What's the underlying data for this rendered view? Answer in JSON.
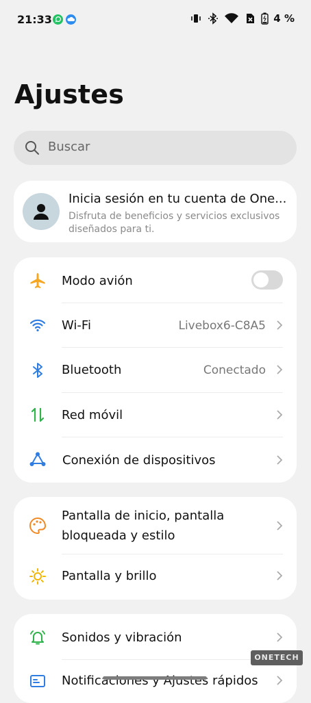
{
  "status_bar": {
    "time": "21:33",
    "battery": "4 %",
    "icons": [
      "whatsapp-icon",
      "cloud-app-icon",
      "vibrate-icon",
      "bluetooth-icon",
      "wifi-icon",
      "no-sim-icon",
      "battery-icon"
    ]
  },
  "page": {
    "title": "Ajustes"
  },
  "search": {
    "placeholder": "Buscar"
  },
  "account": {
    "title": "Inicia sesión en tu cuenta de One...",
    "subtitle": "Disfruta de beneficios y servicios exclusivos diseñados para ti."
  },
  "group1": {
    "airplane": {
      "label": "Modo avión",
      "enabled": false,
      "icon": "airplane-icon",
      "color": "#f5a623"
    },
    "wifi": {
      "label": "Wi-Fi",
      "value": "Livebox6-C8A5",
      "icon": "wifi-icon",
      "color": "#2f7de1"
    },
    "bluetooth": {
      "label": "Bluetooth",
      "value": "Conectado",
      "icon": "bluetooth-icon",
      "color": "#2f7de1"
    },
    "mobile": {
      "label": "Red móvil",
      "icon": "mobile-data-icon",
      "color": "#2fb34a"
    },
    "devices": {
      "label": "Conexión de dispositivos",
      "icon": "device-connection-icon",
      "color": "#2f7de1"
    }
  },
  "group2": {
    "home": {
      "label_line1": "Pantalla de inicio, pantalla",
      "label_line2": "bloqueada y estilo",
      "icon": "palette-icon",
      "color": "#f08a24"
    },
    "display": {
      "label": "Pantalla y brillo",
      "icon": "brightness-icon",
      "color": "#f5b400"
    }
  },
  "group3": {
    "sound": {
      "label": "Sonidos y vibración",
      "icon": "bell-icon",
      "color": "#2fb34a"
    },
    "notifications": {
      "label": "Notificaciones y Ajustes rápidos",
      "icon": "notifications-icon",
      "color": "#2f7de1"
    }
  },
  "watermark": "ONETECH"
}
